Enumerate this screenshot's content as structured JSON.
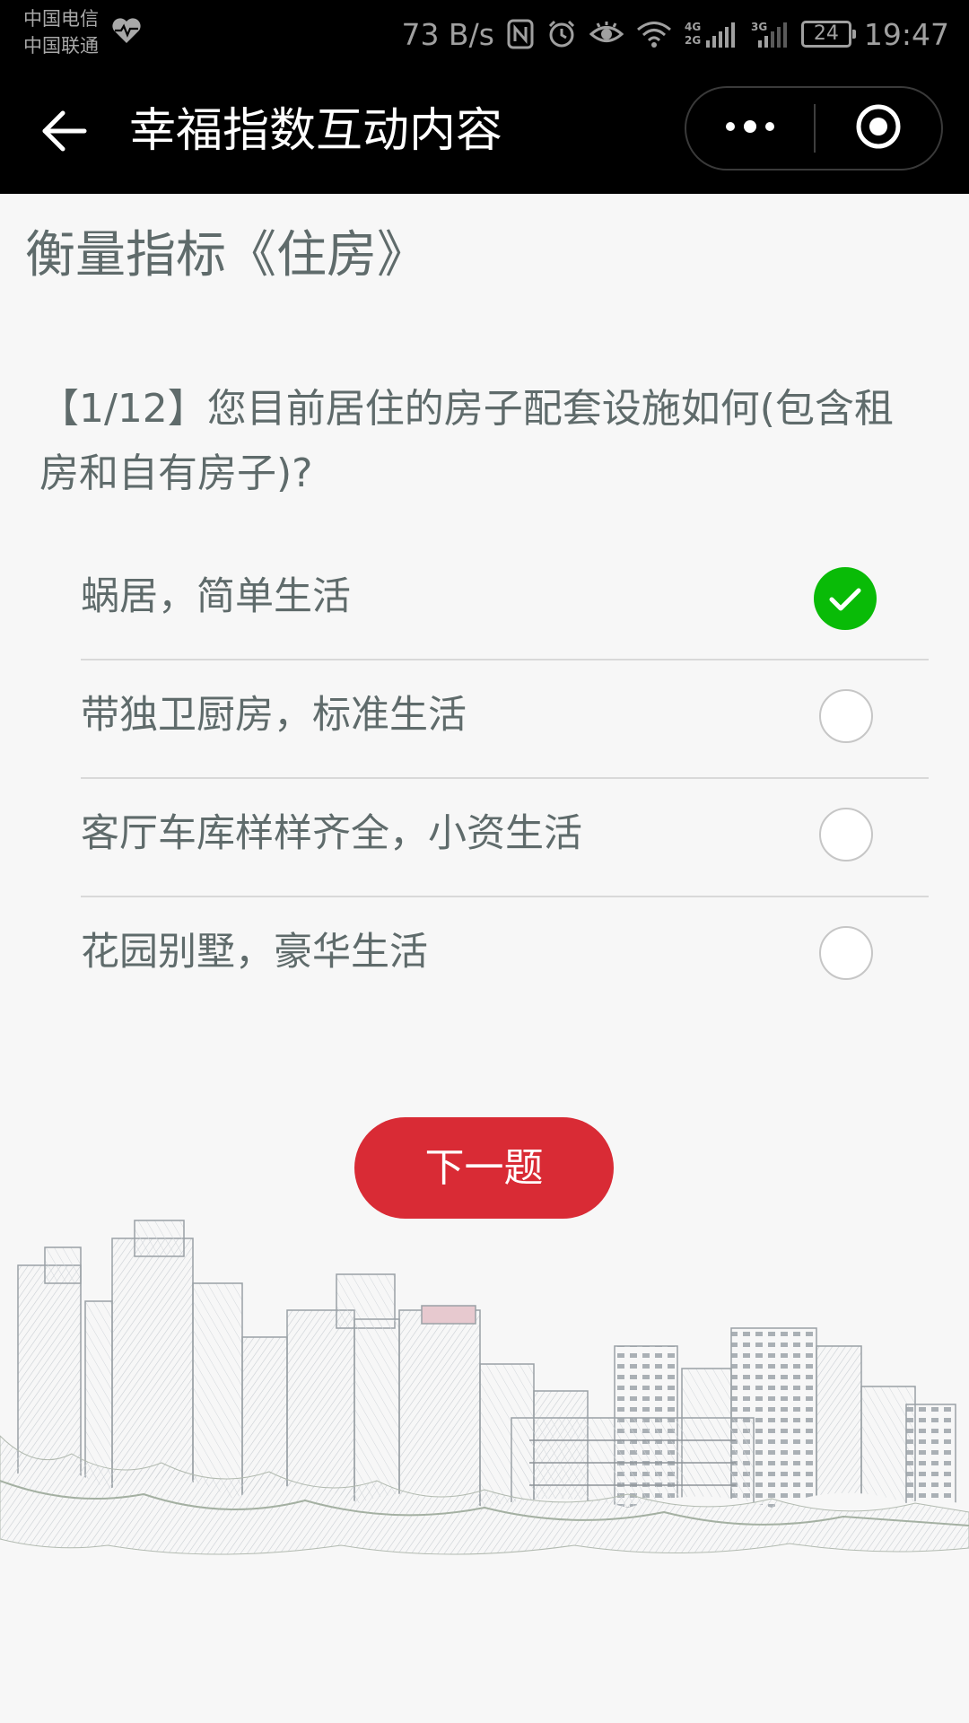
{
  "status_bar": {
    "carrier_1": "中国电信",
    "carrier_2": "中国联通",
    "net_speed": "73 B/s",
    "network_labels": [
      "4G",
      "2G",
      "3G"
    ],
    "battery": "24",
    "time": "19:47",
    "icons": [
      "heart-rate-icon",
      "nfc-icon",
      "alarm-icon",
      "eye-icon",
      "wifi-icon",
      "signal-icon",
      "battery-icon"
    ]
  },
  "nav": {
    "title": "幸福指数互动内容",
    "icons": [
      "back-arrow-icon",
      "more-dots-icon",
      "close-target-icon"
    ]
  },
  "page": {
    "section_title": "衡量指标《住房》",
    "question": "【1/12】您目前居住的房子配套设施如何(包含租房和自有房子)?",
    "options": [
      {
        "label": "蜗居，简单生活",
        "selected": true
      },
      {
        "label": "带独卫厨房，标准生活",
        "selected": false
      },
      {
        "label": "客厅车库样样齐全，小资生活",
        "selected": false
      },
      {
        "label": "花园别墅，豪华生活",
        "selected": false
      }
    ],
    "next_button": "下一题"
  },
  "colors": {
    "status_bar_bg": "#000000",
    "nav_bg": "#000000",
    "page_bg": "#f7f7f7",
    "text": "#5f6b6b",
    "selected_green": "#09bb07",
    "button_red": "#d92b35"
  }
}
